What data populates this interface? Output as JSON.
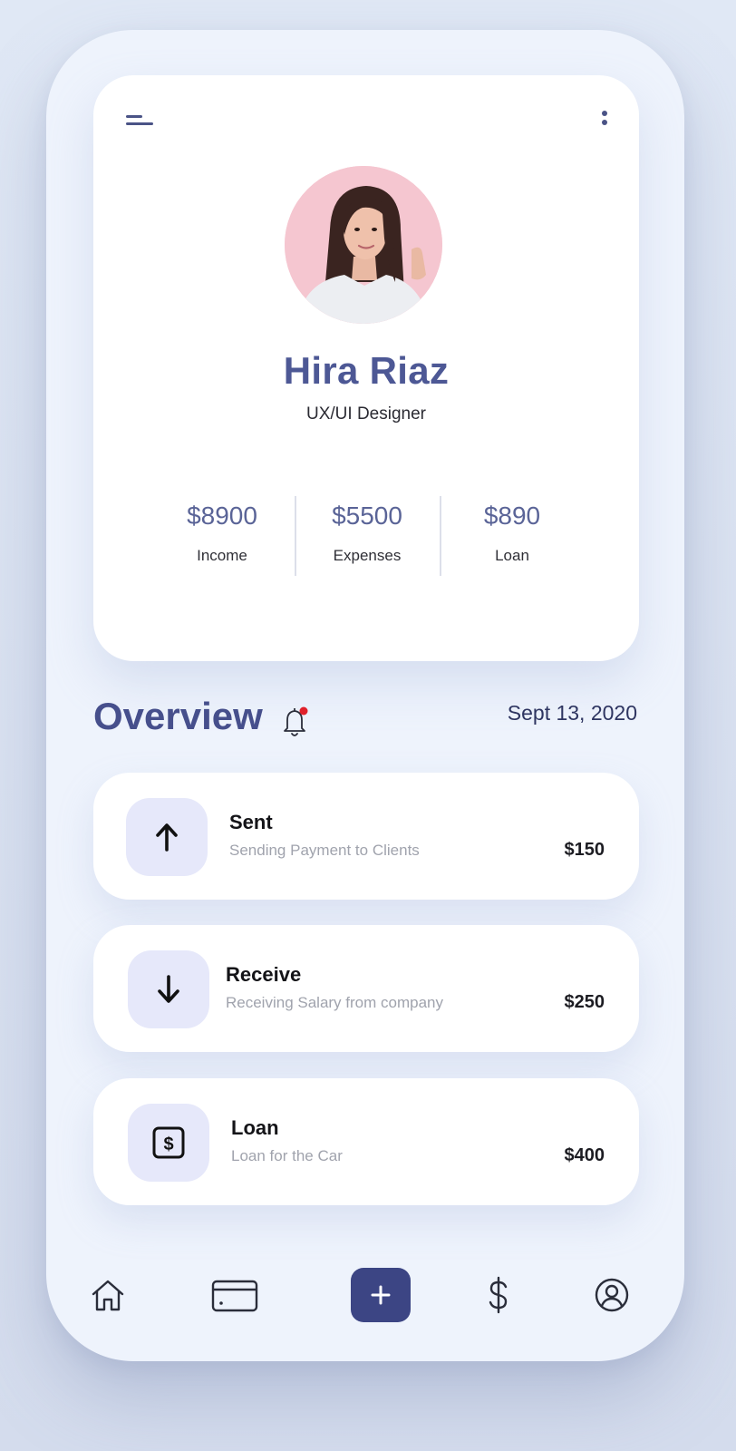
{
  "profile": {
    "name": "Hira Riaz",
    "role": "UX/UI Designer",
    "stats": [
      {
        "value": "$8900",
        "label": "Income"
      },
      {
        "value": "$5500",
        "label": "Expenses"
      },
      {
        "value": "$890",
        "label": "Loan"
      }
    ]
  },
  "overview": {
    "title": "Overview",
    "date": "Sept 13, 2020",
    "has_notification": true
  },
  "transactions": [
    {
      "title": "Sent",
      "description": "Sending Payment to Clients",
      "amount": "$150",
      "icon": "arrow-up-icon"
    },
    {
      "title": "Receive",
      "description": "Receiving Salary from company",
      "amount": "$250",
      "icon": "arrow-down-icon"
    },
    {
      "title": "Loan",
      "description": "Loan for the Car",
      "amount": "$400",
      "icon": "dollar-box-icon"
    }
  ],
  "nav": {
    "items": [
      "home-icon",
      "card-icon",
      "plus-icon",
      "dollar-icon",
      "profile-icon"
    ],
    "active": "plus-icon"
  },
  "colors": {
    "accent": "#464f8c",
    "accent_button": "#3c4584",
    "icon_bg": "#e6e8fa",
    "notification_dot": "#e0202a",
    "avatar_bg": "#f5c6d0"
  }
}
